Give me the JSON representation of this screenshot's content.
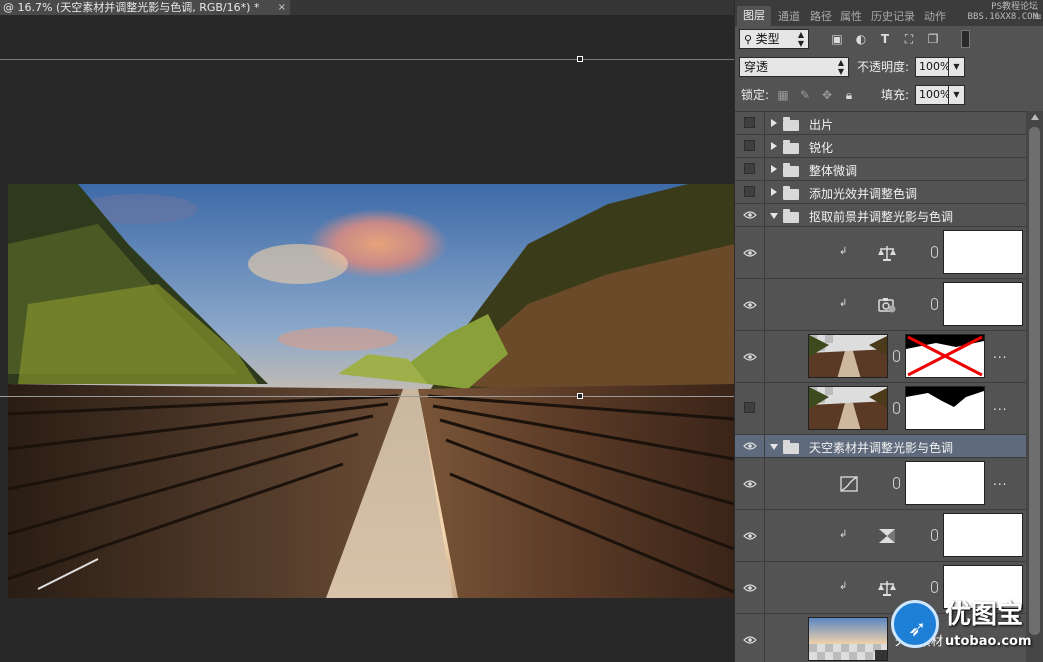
{
  "document": {
    "tab_title": "@ 16.7% (天空素材并调整光影与色调, RGB/16*) *",
    "close_glyph": "×"
  },
  "panel": {
    "tabs": [
      "图层",
      "通道",
      "路径",
      "属性",
      "历史记录",
      "动作"
    ],
    "menu_glyph": "≡",
    "watermark_line1": "PS教程论坛",
    "watermark_line2": "BBS.16XX8.COM",
    "filter_kind": "类型",
    "filter_icons": [
      "image-filter-icon",
      "adjustment-filter-icon",
      "type-filter-icon",
      "shape-filter-icon",
      "smart-object-filter-icon"
    ],
    "blend_mode": "穿透",
    "opacity_label": "不透明度:",
    "opacity_value": "100%",
    "lock_label": "锁定:",
    "lock_icons": [
      "lock-transparent-icon",
      "lock-paint-icon",
      "lock-position-icon",
      "lock-all-icon"
    ],
    "fill_label": "填充:",
    "fill_value": "100%"
  },
  "layers": [
    {
      "kind": "group",
      "name": "出片",
      "visible": false,
      "expanded": false
    },
    {
      "kind": "group",
      "name": "锐化",
      "visible": false,
      "expanded": false
    },
    {
      "kind": "group",
      "name": "整体微调",
      "visible": false,
      "expanded": false
    },
    {
      "kind": "group",
      "name": "添加光效并调整色调",
      "visible": false,
      "expanded": false
    },
    {
      "kind": "group",
      "name": "抠取前景并调整光影与色调",
      "visible": true,
      "expanded": true
    },
    {
      "kind": "adjustment",
      "icon": "color-balance-icon",
      "clipped": true,
      "visible": true,
      "name": ""
    },
    {
      "kind": "adjustment",
      "icon": "photo-filter-icon",
      "clipped": true,
      "visible": true,
      "name": ""
    },
    {
      "kind": "image",
      "name": "...",
      "visible": true,
      "mask_crossed": true
    },
    {
      "kind": "image",
      "name": "...",
      "visible": false,
      "mask_crossed": false
    },
    {
      "kind": "group",
      "name": "天空素材并调整光影与色调",
      "visible": true,
      "expanded": true,
      "selected": true
    },
    {
      "kind": "adjustment",
      "icon": "curves-icon",
      "clipped": false,
      "visible": true,
      "name": "..."
    },
    {
      "kind": "adjustment",
      "icon": "gradient-map-icon",
      "clipped": true,
      "visible": true,
      "name": ""
    },
    {
      "kind": "adjustment",
      "icon": "color-balance-icon",
      "clipped": true,
      "visible": true,
      "name": ""
    },
    {
      "kind": "sky",
      "name": "天空素材",
      "visible": true
    }
  ],
  "brand": {
    "name": "优图宝",
    "url": "utobao.com"
  },
  "colors": {
    "panel_bg": "#535353",
    "selected_row": "#5f6b7d",
    "canvas_bg": "#282828",
    "brand_blue": "#1e7fd6"
  }
}
